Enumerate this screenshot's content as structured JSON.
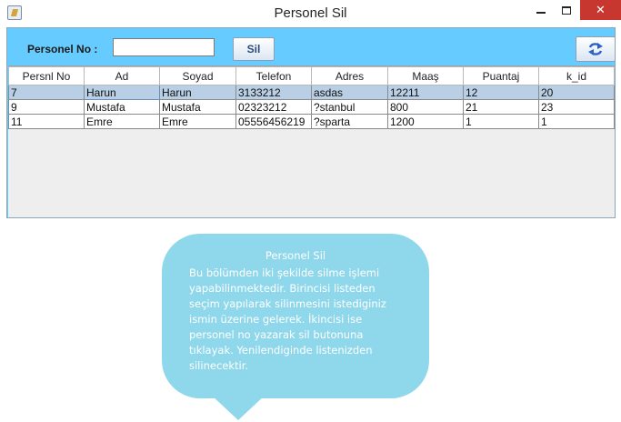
{
  "window": {
    "title": "Personel Sil",
    "minimize_icon": "minimize-icon",
    "maximize_icon": "maximize-icon",
    "close_icon": "close-icon",
    "close_glyph": "✕"
  },
  "form": {
    "personel_no_label": "Personel No :",
    "personel_no_value": "",
    "sil_button_label": "Sil",
    "refresh_icon": "refresh-icon"
  },
  "table": {
    "columns": [
      "Persnl No",
      "Ad",
      "Soyad",
      "Telefon",
      "Adres",
      "Maaş",
      "Puantaj",
      "k_id"
    ],
    "rows": [
      [
        "7",
        "Harun",
        "Harun",
        "3133212",
        "asdas",
        "12211",
        "12",
        "20"
      ],
      [
        "9",
        "Mustafa",
        "Mustafa",
        "02323212",
        "?stanbul",
        "800",
        "21",
        "23"
      ],
      [
        "11",
        "Emre",
        "Emre",
        "05556456219",
        "?sparta",
        "1200",
        "1",
        "1"
      ]
    ],
    "selected_row": 0
  },
  "tooltip": {
    "title": "Personel Sil",
    "text": "Bu bölümden iki şekilde silme işlemi\nyapabilinmektedir. Birincisi listeden\nseçim yapılarak silinmesini istediginiz\nismin üzerine gelerek. İkincisi ise\npersonel no  yazarak sil butonuna\ntıklayak. Yenilendiginde listenizden\nsilinecektir."
  },
  "colors": {
    "panel_bg": "#66ccff",
    "selected_row": "#b8cfe5",
    "bubble": "#8fd7ea",
    "close_button": "#c7362f"
  }
}
